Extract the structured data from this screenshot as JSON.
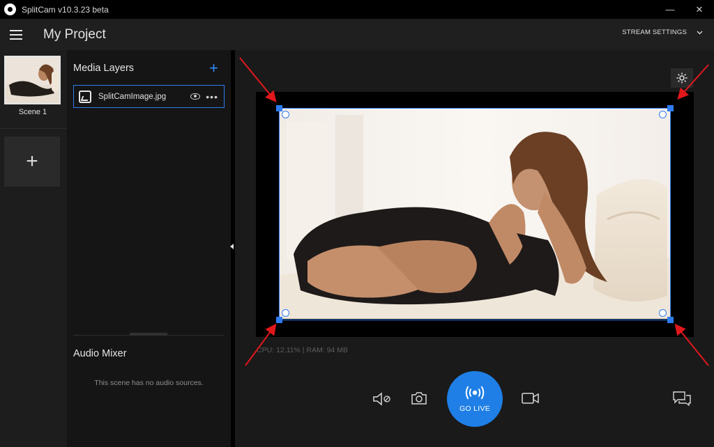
{
  "window": {
    "title": "SplitCam v10.3.23 beta",
    "minimize": "—",
    "close": "✕"
  },
  "header": {
    "project_title": "My Project",
    "stream_settings": "STREAM SETTINGS"
  },
  "scenes": {
    "items": [
      {
        "label": "Scene 1"
      }
    ],
    "add": "+"
  },
  "layers": {
    "title": "Media Layers",
    "add": "+",
    "items": [
      {
        "name": "SplitCamImage.jpg"
      }
    ]
  },
  "audio": {
    "title": "Audio Mixer",
    "empty": "This scene has no audio sources."
  },
  "preview": {
    "stats": "CPU: 12.11% | RAM: 94 MB"
  },
  "controls": {
    "go_live": "GO LIVE"
  },
  "colors": {
    "accent": "#2f7cf0",
    "go_live": "#1f7fe6",
    "annotation": "#e0181c"
  }
}
